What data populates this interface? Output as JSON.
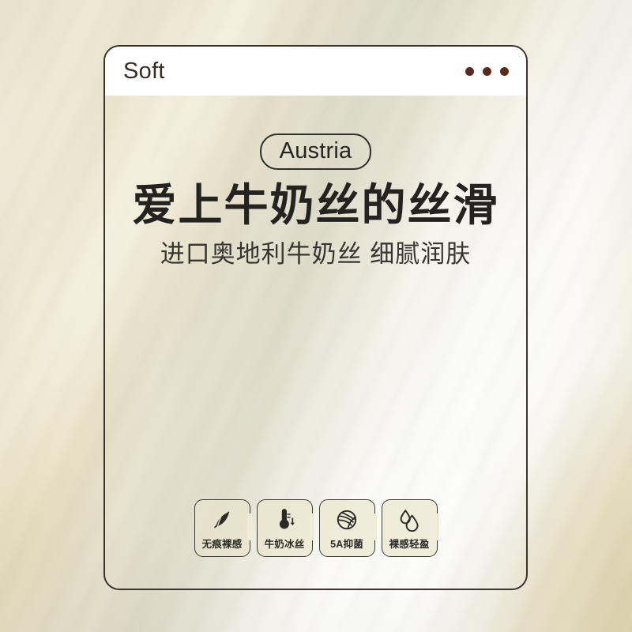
{
  "card": {
    "header": {
      "title": "Soft",
      "window_dots_count": 3,
      "dot_color": "#5b2a1c"
    },
    "hero": {
      "badge": "Austria",
      "headline": "爱上牛奶丝的丝滑",
      "subheadline": "进口奥地利牛奶丝 细腻润肤"
    },
    "features": [
      {
        "label": "无痕裸感",
        "icon": "leaf-icon"
      },
      {
        "label": "牛奶冰丝",
        "icon": "thermometer-down-icon"
      },
      {
        "label": "5A抑菌",
        "icon": "yarn-ball-icon"
      },
      {
        "label": "裸感轻盈",
        "icon": "water-drops-icon"
      }
    ],
    "border_color": "#3a332e",
    "header_bg": "#ffffff"
  },
  "background": {
    "description": "silk milk-fiber fabric drape",
    "base_color": "#f1ead5",
    "highlight_color": "#ffffff",
    "warm_color": "#e0ce96"
  }
}
